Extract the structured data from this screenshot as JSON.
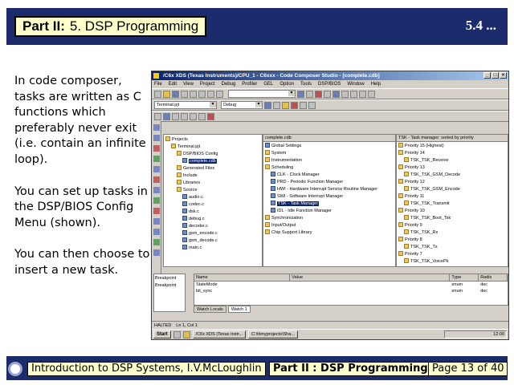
{
  "header": {
    "part_label": "Part II:",
    "part_title": "5. DSP Programming",
    "slide_number": "5.4 ..."
  },
  "body_text": [
    "In code composer, tasks are written as C functions which preferably never exit (i.e. contain an infinite loop).",
    "You can set up tasks in the DSP/BIOS Config Menu (shown).",
    "You can then choose to insert a new task."
  ],
  "screenshot": {
    "title": "/C6x XDS (Texas Instruments)/CPU_1 - C6xxx - Code Composer Studio - [complete.cdb]",
    "menu": [
      "File",
      "Edit",
      "View",
      "Project",
      "Debug",
      "Profiler",
      "GEL",
      "Option",
      "Tools",
      "DSP/BIOS",
      "Window",
      "Help"
    ],
    "project_combo": "Terminal.pjt",
    "config_combo": "Debug",
    "project_tree": [
      {
        "label": "Projects",
        "indent": 0,
        "kind": "folder"
      },
      {
        "label": "Terminal.pjt",
        "indent": 1,
        "kind": "folder"
      },
      {
        "label": "DSP/BIOS Config",
        "indent": 2,
        "kind": "folder"
      },
      {
        "label": "complete.cdb",
        "indent": 3,
        "kind": "file",
        "selected": true
      },
      {
        "label": "Generated Files",
        "indent": 2,
        "kind": "folder"
      },
      {
        "label": "Include",
        "indent": 2,
        "kind": "folder"
      },
      {
        "label": "Libraries",
        "indent": 2,
        "kind": "folder"
      },
      {
        "label": "Source",
        "indent": 2,
        "kind": "folder"
      },
      {
        "label": "audio.c",
        "indent": 3,
        "kind": "file"
      },
      {
        "label": "codec.c",
        "indent": 3,
        "kind": "file"
      },
      {
        "label": "dsk.c",
        "indent": 3,
        "kind": "file"
      },
      {
        "label": "debug.c",
        "indent": 3,
        "kind": "file"
      },
      {
        "label": "decoder.c",
        "indent": 3,
        "kind": "file"
      },
      {
        "label": "gsm_encode.c",
        "indent": 3,
        "kind": "file"
      },
      {
        "label": "gsm_decode.c",
        "indent": 3,
        "kind": "file"
      },
      {
        "label": "main.c",
        "indent": 3,
        "kind": "file"
      }
    ],
    "config_tree": [
      {
        "label": "Global Settings",
        "indent": 0,
        "kind": "module"
      },
      {
        "label": "System",
        "indent": 0,
        "kind": "folder"
      },
      {
        "label": "Instrumentation",
        "indent": 0,
        "kind": "folder"
      },
      {
        "label": "Scheduling",
        "indent": 0,
        "kind": "folder"
      },
      {
        "label": "CLK - Clock Manager",
        "indent": 1,
        "kind": "module"
      },
      {
        "label": "PRD - Periodic Function Manager",
        "indent": 1,
        "kind": "module"
      },
      {
        "label": "HWI - Hardware Interrupt Service Routine Manager",
        "indent": 1,
        "kind": "module"
      },
      {
        "label": "SWI - Software Interrupt Manager",
        "indent": 1,
        "kind": "module"
      },
      {
        "label": "TSK - Task Manager",
        "indent": 1,
        "kind": "module",
        "selected": true
      },
      {
        "label": "IDL - Idle Function Manager",
        "indent": 1,
        "kind": "module"
      },
      {
        "label": "Synchronization",
        "indent": 0,
        "kind": "folder"
      },
      {
        "label": "Input/Output",
        "indent": 0,
        "kind": "folder"
      },
      {
        "label": "Chip Support Library",
        "indent": 0,
        "kind": "folder"
      }
    ],
    "priority_header": "TSK - Task manager: sorted by priority",
    "priority_tree": [
      {
        "label": "Priority 15 (Highest)",
        "indent": 0
      },
      {
        "label": "Priority 14",
        "indent": 0
      },
      {
        "label": "TSK_TSK_Receive",
        "indent": 1
      },
      {
        "label": "Priority 13",
        "indent": 0
      },
      {
        "label": "TSK_TSK_GSM_Decode",
        "indent": 1
      },
      {
        "label": "Priority 12",
        "indent": 0
      },
      {
        "label": "TSK_TSK_GSM_Encode",
        "indent": 1
      },
      {
        "label": "Priority 11",
        "indent": 0
      },
      {
        "label": "TSK_TSK_Transmit",
        "indent": 1
      },
      {
        "label": "Priority 10",
        "indent": 0
      },
      {
        "label": "TSK_TSK_Boot_Tsk",
        "indent": 1
      },
      {
        "label": "Priority 9",
        "indent": 0
      },
      {
        "label": "TSK_TSK_Rx",
        "indent": 1
      },
      {
        "label": "Priority 8",
        "indent": 0
      },
      {
        "label": "TSK_TSK_Tx",
        "indent": 1
      },
      {
        "label": "Priority 7",
        "indent": 0
      },
      {
        "label": "TSK_TSK_VoicePk",
        "indent": 1
      }
    ],
    "watch": {
      "columns": [
        "Name",
        "Value",
        "Type",
        "Radix"
      ],
      "rows": [
        [
          "StateMode",
          "",
          "enum",
          "dec"
        ],
        [
          "bit_sync",
          "",
          "enum",
          "dec"
        ]
      ],
      "tabs": [
        "Watch Locals",
        "Watch 1"
      ]
    },
    "output_labels": [
      "Breakpoint",
      "Breakpoint"
    ],
    "status": [
      "HALTED",
      "Ln 1, Col 1"
    ],
    "taskbar": {
      "start": "Start",
      "tasks": [
        "/C6x XDS (Texas Instr...",
        "C:\\ti\\myprojects\\Sha..."
      ],
      "tray": "12:00"
    }
  },
  "footer": {
    "course": "Introduction to DSP Systems, I.V.McLoughlin",
    "section": "Part II :  DSP Programming",
    "page": "Page 13 of 40"
  }
}
